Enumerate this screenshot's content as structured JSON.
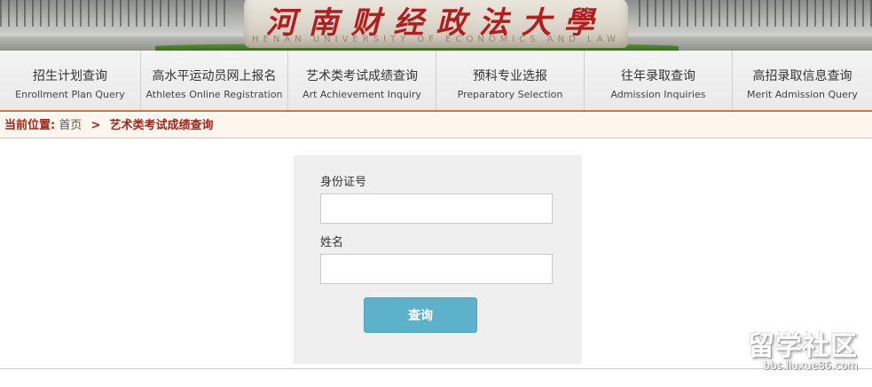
{
  "banner": {
    "title": "河南财经政法大學",
    "subtitle": "HENAN UNIVERSITY OF ECONOMICS AND LAW"
  },
  "nav": [
    {
      "cn": "招生计划查询",
      "en": "Enrollment Plan Query"
    },
    {
      "cn": "高水平运动员网上报名",
      "en": "Athletes Online Registration"
    },
    {
      "cn": "艺术类考试成绩查询",
      "en": "Art Achievement Inquiry"
    },
    {
      "cn": "预科专业选报",
      "en": "Preparatory  Selection"
    },
    {
      "cn": "往年录取查询",
      "en": "Admission Inquiries"
    },
    {
      "cn": "高招录取信息查询",
      "en": "Merit Admission Query"
    }
  ],
  "breadcrumb": {
    "label": "当前位置:",
    "home": "首页",
    "separator": ">",
    "current": "艺术类考试成绩查询"
  },
  "form": {
    "id_label": "身份证号",
    "id_value": "",
    "name_label": "姓名",
    "name_value": "",
    "submit_label": "查询"
  },
  "watermark": {
    "main": "留学社区",
    "url": "bbs.liuxue86.com"
  },
  "colors": {
    "brand_red": "#a42419",
    "nav_border": "#c87a35",
    "button": "#5cb2ca"
  }
}
